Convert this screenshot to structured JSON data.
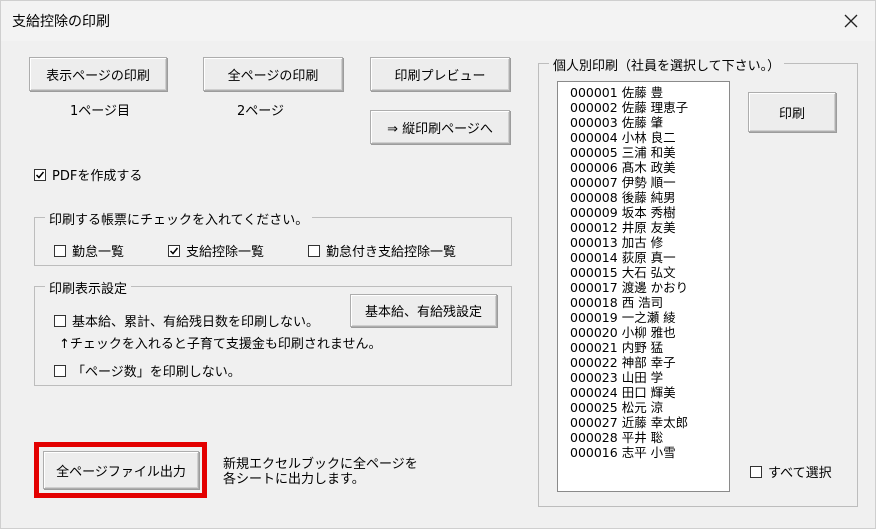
{
  "window": {
    "title": "支給控除の印刷"
  },
  "buttons": {
    "print_current_page": "表示ページの印刷",
    "print_all_pages": "全ページの印刷",
    "print_preview": "印刷プレビュー",
    "vertical_print": "⇒ 縦印刷ページへ",
    "base_salary_settings": "基本給、有給残設定",
    "export_all_pages": "全ページファイル出力",
    "print_individual": "印刷"
  },
  "page_labels": {
    "current": "1ページ目",
    "total": "2ページ"
  },
  "pdf_checkbox": {
    "label": "PDFを作成する",
    "checked": true
  },
  "report_group": {
    "title": "印刷する帳票にチェックを入れてください。",
    "items": [
      {
        "label": "勤怠一覧",
        "checked": false
      },
      {
        "label": "支給控除一覧",
        "checked": true
      },
      {
        "label": "勤怠付き支給控除一覧",
        "checked": false
      }
    ]
  },
  "display_group": {
    "title": "印刷表示設定",
    "no_salary_label": "基本給、累計、有給残日数を印刷しない。",
    "no_salary_checked": false,
    "note": "↑チェックを入れると子育て支援金も印刷されません。",
    "no_page_number_label": "「ページ数」を印刷しない。",
    "no_page_number_checked": false
  },
  "export_note": {
    "line1": "新規エクセルブックに全ページを",
    "line2": "各シートに出力します。"
  },
  "individual_group": {
    "title": "個人別印刷（社員を選択して下さい。）",
    "employees": [
      "000001  佐藤  豊",
      "000002  佐藤  理恵子",
      "000003  佐藤  肇",
      "000004  小林  良二",
      "000005  三浦   和美",
      "000006  髙木  政美",
      "000007  伊勢   順一",
      "000008  後藤  純男",
      "000009  坂本  秀樹",
      "000012  井原  友美",
      "000013  加古  修",
      "000014  荻原  真一",
      "000015  大石  弘文",
      "000017  渡邊  かおり",
      "000018  西  浩司",
      "000019  一之瀬  綾",
      "000020  小柳  雅也",
      "000021  内野  猛",
      "000022  神部  幸子",
      "000023  山田  学",
      "000024  田口  輝美",
      "000025  松元  涼",
      "000027  近藤  幸太郎",
      "000028  平井  聡",
      "000016  志平  小雪"
    ],
    "select_all_label": "すべて選択",
    "select_all_checked": false
  }
}
